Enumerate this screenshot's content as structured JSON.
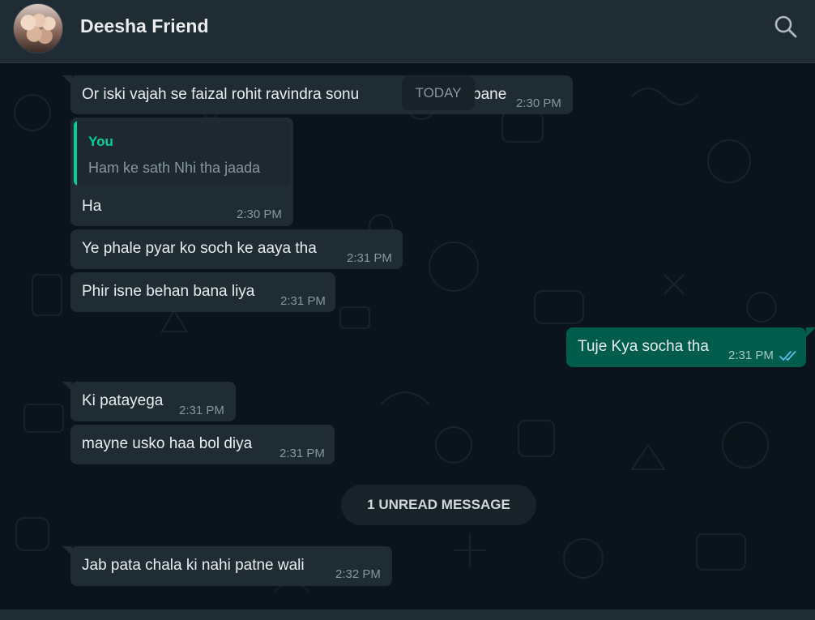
{
  "header": {
    "contact_name": "Deesha Friend",
    "avatar_icon": "group-photo-avatar",
    "search_icon": "search-icon"
  },
  "date_divider": "TODAY",
  "unread_divider": "1 UNREAD MESSAGE",
  "messages": [
    {
      "direction": "in",
      "text": "Or iski vajah se faizal  rohit ravindra  sonu",
      "trailing_text": "pane",
      "time": "2:30 PM"
    },
    {
      "direction": "in",
      "quoted": {
        "author": "You",
        "text": "Ham ke sath Nhi tha jaada"
      },
      "text": "Ha",
      "time": "2:30 PM"
    },
    {
      "direction": "in",
      "text": "Ye phale pyar ko soch ke aaya tha",
      "time": "2:31 PM"
    },
    {
      "direction": "in",
      "text": "Phir isne behan bana liya",
      "time": "2:31 PM"
    },
    {
      "direction": "out",
      "text": "Tuje Kya socha tha",
      "time": "2:31 PM",
      "status": "read"
    },
    {
      "direction": "in",
      "text": "Ki patayega",
      "time": "2:31 PM"
    },
    {
      "direction": "in",
      "text": "mayne usko haa bol diya",
      "time": "2:31 PM"
    },
    {
      "direction": "in",
      "text": "Jab pata chala ki nahi patne wali",
      "time": "2:32 PM"
    }
  ],
  "colors": {
    "header_bg": "#202c33",
    "chat_bg": "#0b141a",
    "incoming_bubble": "#202c33",
    "outgoing_bubble": "#005c4b",
    "accent": "#06cf9c",
    "read_ticks": "#53bdeb"
  }
}
